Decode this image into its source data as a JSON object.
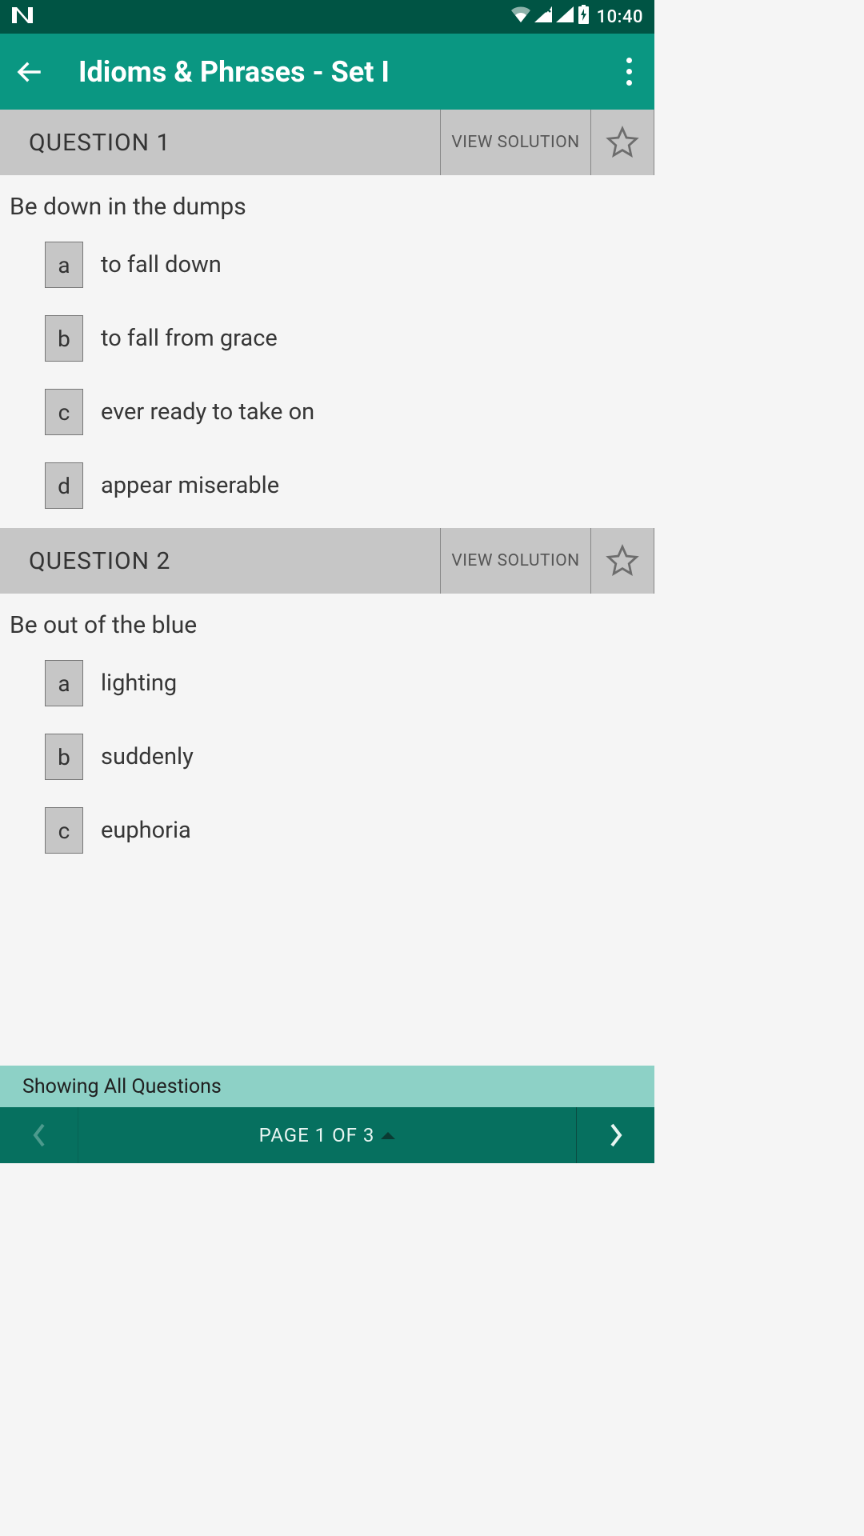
{
  "status": {
    "time": "10:40",
    "icons": {
      "wifi": "wifi-icon",
      "signal_x": "signal-x-icon",
      "signal": "signal-full-icon",
      "battery": "battery-charging-icon"
    }
  },
  "header": {
    "title": "Idioms & Phrases - Set I"
  },
  "questions": [
    {
      "label": "QUESTION 1",
      "solution_label": "VIEW SOLUTION",
      "text": "Be down in the dumps",
      "options": [
        {
          "letter": "a",
          "text": "to fall down"
        },
        {
          "letter": "b",
          "text": "to fall from grace"
        },
        {
          "letter": "c",
          "text": "ever ready to take on"
        },
        {
          "letter": "d",
          "text": "appear miserable"
        }
      ]
    },
    {
      "label": "QUESTION 2",
      "solution_label": "VIEW SOLUTION",
      "text": "Be out of the blue",
      "options": [
        {
          "letter": "a",
          "text": "lighting"
        },
        {
          "letter": "b",
          "text": "suddenly"
        },
        {
          "letter": "c",
          "text": "euphoria"
        }
      ]
    }
  ],
  "showing_banner": "Showing All Questions",
  "footer": {
    "page_label": "PAGE 1 OF 3"
  }
}
